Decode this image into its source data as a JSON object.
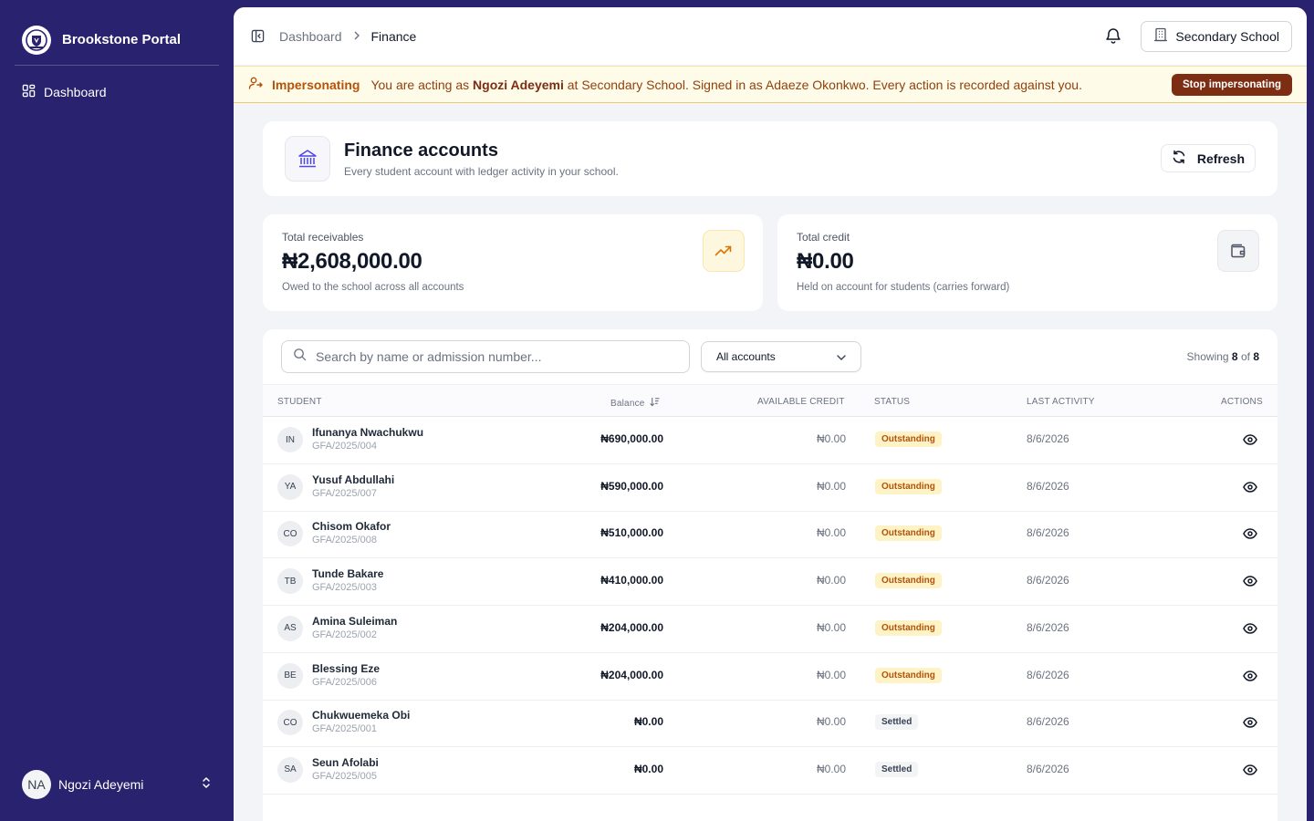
{
  "sidebar": {
    "brand_name": "Brookstone Portal",
    "nav": [
      {
        "label": "Dashboard",
        "icon": "grid-icon"
      }
    ],
    "user": {
      "initials": "NA",
      "name": "Ngozi Adeyemi"
    }
  },
  "topbar": {
    "breadcrumb": [
      "Dashboard",
      "Finance"
    ],
    "school_button": "Secondary School"
  },
  "banner": {
    "label": "Impersonating",
    "text_before": "You are acting as ",
    "acting_as": "Ngozi Adeyemi",
    "text_after": " at Secondary School. Signed in as Adaeze Okonkwo. Every action is recorded against you.",
    "stop_button": "Stop impersonating"
  },
  "page": {
    "title": "Finance accounts",
    "subtitle": "Every student account with ledger activity in your school.",
    "refresh_label": "Refresh"
  },
  "stats": {
    "receivables": {
      "label": "Total receivables",
      "value": "₦2,608,000.00",
      "sub": "Owed to the school across all accounts",
      "icon": "trending-up-icon",
      "accent": "#d97706"
    },
    "credit": {
      "label": "Total credit",
      "value": "₦0.00",
      "sub": "Held on account for students (carries forward)",
      "icon": "wallet-icon",
      "accent": "#4b5563"
    }
  },
  "filters": {
    "search_placeholder": "Search by name or admission number...",
    "account_filter": "All accounts",
    "showing_prefix": "Showing",
    "showing_count": "8",
    "showing_of": "of",
    "showing_total": "8"
  },
  "table": {
    "headers": {
      "student": "Student",
      "balance": "Balance",
      "credit": "Available Credit",
      "status": "Status",
      "last_activity": "Last Activity",
      "actions": "Actions"
    },
    "rows": [
      {
        "initials": "IN",
        "name": "Ifunanya Nwachukwu",
        "admission": "GFA/2025/004",
        "balance": "₦690,000.00",
        "credit": "₦0.00",
        "status": "Outstanding",
        "date": "8/6/2026"
      },
      {
        "initials": "YA",
        "name": "Yusuf Abdullahi",
        "admission": "GFA/2025/007",
        "balance": "₦590,000.00",
        "credit": "₦0.00",
        "status": "Outstanding",
        "date": "8/6/2026"
      },
      {
        "initials": "CO",
        "name": "Chisom Okafor",
        "admission": "GFA/2025/008",
        "balance": "₦510,000.00",
        "credit": "₦0.00",
        "status": "Outstanding",
        "date": "8/6/2026"
      },
      {
        "initials": "TB",
        "name": "Tunde Bakare",
        "admission": "GFA/2025/003",
        "balance": "₦410,000.00",
        "credit": "₦0.00",
        "status": "Outstanding",
        "date": "8/6/2026"
      },
      {
        "initials": "AS",
        "name": "Amina Suleiman",
        "admission": "GFA/2025/002",
        "balance": "₦204,000.00",
        "credit": "₦0.00",
        "status": "Outstanding",
        "date": "8/6/2026"
      },
      {
        "initials": "BE",
        "name": "Blessing Eze",
        "admission": "GFA/2025/006",
        "balance": "₦204,000.00",
        "credit": "₦0.00",
        "status": "Outstanding",
        "date": "8/6/2026"
      },
      {
        "initials": "CO",
        "name": "Chukwuemeka Obi",
        "admission": "GFA/2025/001",
        "balance": "₦0.00",
        "credit": "₦0.00",
        "status": "Settled",
        "date": "8/6/2026"
      },
      {
        "initials": "SA",
        "name": "Seun Afolabi",
        "admission": "GFA/2025/005",
        "balance": "₦0.00",
        "credit": "₦0.00",
        "status": "Settled",
        "date": "8/6/2026"
      }
    ]
  },
  "colors": {
    "sidebar_bg": "#28226f",
    "banner_bg": "#fefbe8",
    "stop_button": "#7c2d12",
    "outstanding_bg": "#fdf3c7",
    "outstanding_text": "#b45309"
  }
}
